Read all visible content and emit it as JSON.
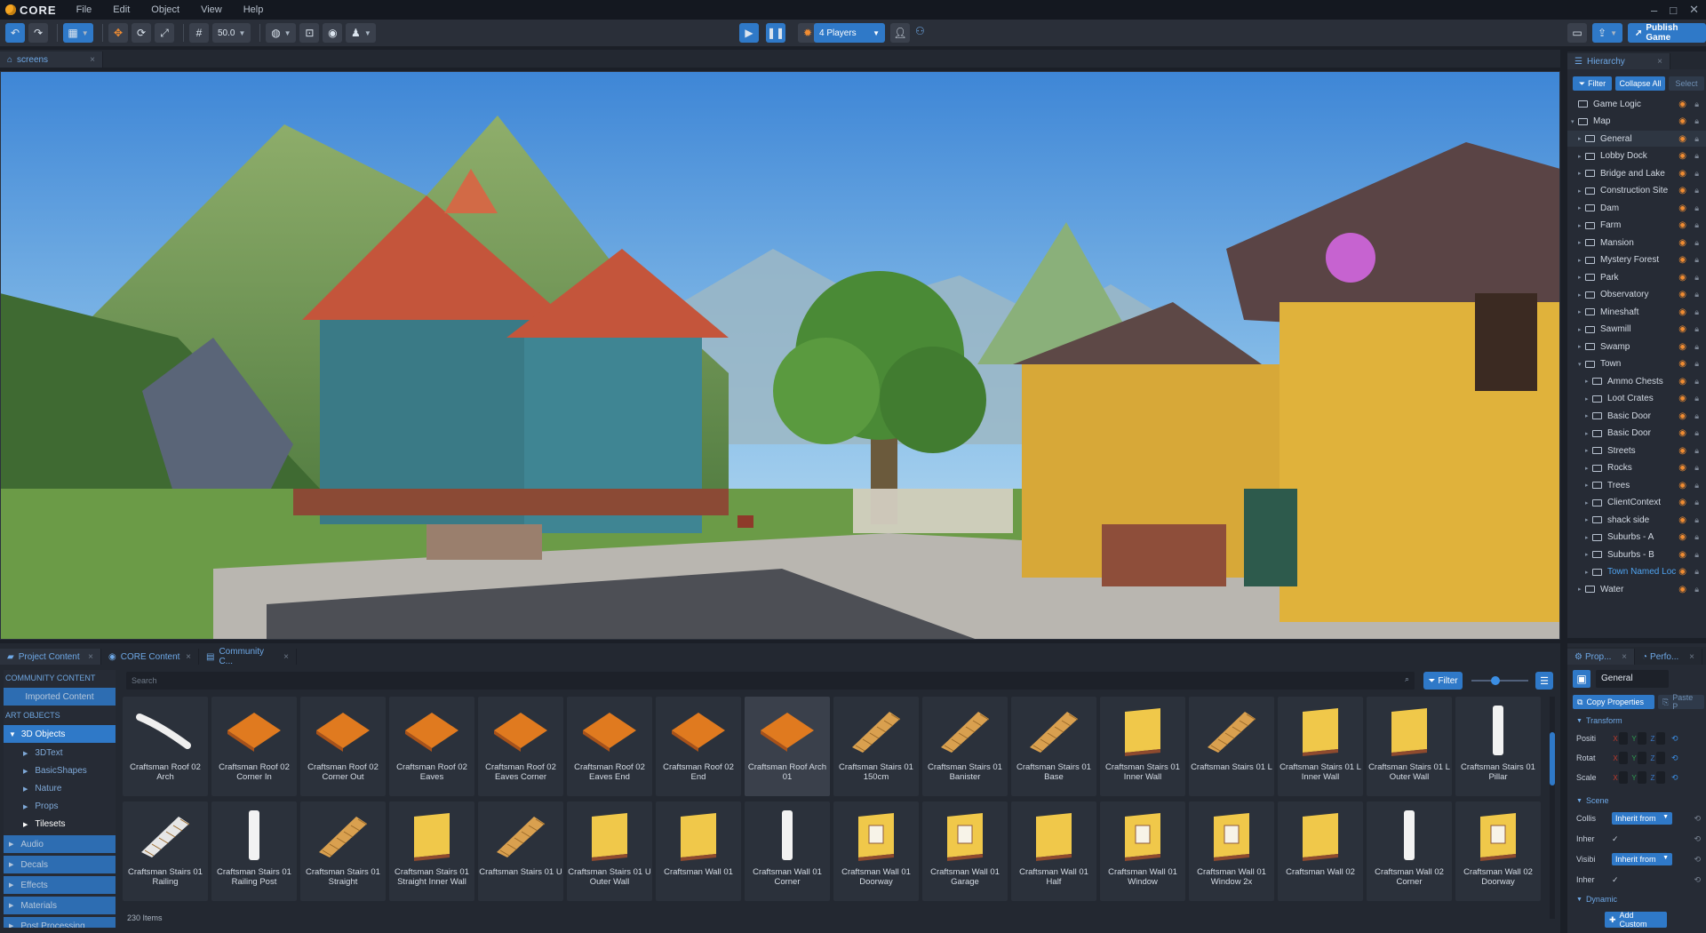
{
  "app": {
    "logo": "CORE"
  },
  "menu": [
    "File",
    "Edit",
    "Object",
    "View",
    "Help"
  ],
  "toolbar": {
    "snap_value": "50.0",
    "players_label": "4 Players",
    "publish_label": "Publish Game"
  },
  "viewport": {
    "tab_label": "screens"
  },
  "hierarchy": {
    "tab_label": "Hierarchy",
    "filter_label": "Filter",
    "collapse_label": "Collapse All",
    "select_label": "Select",
    "items": [
      {
        "label": "Game Logic",
        "depth": 0,
        "expander": ""
      },
      {
        "label": "Map",
        "depth": 0,
        "expander": "▾"
      },
      {
        "label": "General",
        "depth": 1,
        "expander": "▸",
        "selected": true
      },
      {
        "label": "Lobby Dock",
        "depth": 1,
        "expander": "▸"
      },
      {
        "label": "Bridge and Lake",
        "depth": 1,
        "expander": "▸"
      },
      {
        "label": "Construction Site",
        "depth": 1,
        "expander": "▸"
      },
      {
        "label": "Dam",
        "depth": 1,
        "expander": "▸"
      },
      {
        "label": "Farm",
        "depth": 1,
        "expander": "▸"
      },
      {
        "label": "Mansion",
        "depth": 1,
        "expander": "▸"
      },
      {
        "label": "Mystery Forest",
        "depth": 1,
        "expander": "▸"
      },
      {
        "label": "Park",
        "depth": 1,
        "expander": "▸"
      },
      {
        "label": "Observatory",
        "depth": 1,
        "expander": "▸"
      },
      {
        "label": "Mineshaft",
        "depth": 1,
        "expander": "▸"
      },
      {
        "label": "Sawmill",
        "depth": 1,
        "expander": "▸"
      },
      {
        "label": "Swamp",
        "depth": 1,
        "expander": "▸"
      },
      {
        "label": "Town",
        "depth": 1,
        "expander": "▾"
      },
      {
        "label": "Ammo Chests",
        "depth": 2,
        "expander": "▸"
      },
      {
        "label": "Loot Crates",
        "depth": 2,
        "expander": "▸"
      },
      {
        "label": "Basic Door",
        "depth": 2,
        "expander": "▸"
      },
      {
        "label": "Basic Door",
        "depth": 2,
        "expander": "▸"
      },
      {
        "label": "Streets",
        "depth": 2,
        "expander": "▸"
      },
      {
        "label": "Rocks",
        "depth": 2,
        "expander": "▸"
      },
      {
        "label": "Trees",
        "depth": 2,
        "expander": "▸"
      },
      {
        "label": "ClientContext",
        "depth": 2,
        "expander": "▸"
      },
      {
        "label": "shack side",
        "depth": 2,
        "expander": "▸"
      },
      {
        "label": "Suburbs - A",
        "depth": 2,
        "expander": "▸"
      },
      {
        "label": "Suburbs - B",
        "depth": 2,
        "expander": "▸"
      },
      {
        "label": "Town Named Loc",
        "depth": 2,
        "expander": "▸",
        "blue": true
      },
      {
        "label": "Water",
        "depth": 1,
        "expander": "▸"
      }
    ]
  },
  "content": {
    "tabs": [
      "Project Content",
      "CORE Content",
      "Community C..."
    ],
    "search_placeholder": "Search",
    "filter_label": "Filter",
    "item_count": "230 Items",
    "sidebar": {
      "community_head": "COMMUNITY CONTENT",
      "imported": "Imported Content",
      "art_head": "ART OBJECTS",
      "objects": "3D Objects",
      "children": [
        "3DText",
        "BasicShapes",
        "Nature",
        "Props",
        "Tilesets"
      ],
      "groups": [
        "Audio",
        "Decals",
        "Effects",
        "Materials",
        "Post Processing"
      ]
    },
    "items": [
      {
        "label": "Craftsman Roof 02 Arch",
        "icon": "arch-beam-icon"
      },
      {
        "label": "Craftsman Roof 02 Corner In",
        "icon": "roof-corner-in-icon"
      },
      {
        "label": "Craftsman Roof 02 Corner Out",
        "icon": "roof-corner-out-icon"
      },
      {
        "label": "Craftsman Roof 02 Eaves",
        "icon": "roof-eaves-icon"
      },
      {
        "label": "Craftsman Roof 02 Eaves Corner",
        "icon": "roof-eaves-corner-icon"
      },
      {
        "label": "Craftsman Roof 02 Eaves End",
        "icon": "roof-eaves-end-icon"
      },
      {
        "label": "Craftsman Roof 02 End",
        "icon": "roof-end-icon"
      },
      {
        "label": "Craftsman Roof Arch 01",
        "icon": "roof-arch-icon"
      },
      {
        "label": "Craftsman Stairs 01 150cm",
        "icon": "stairs-icon"
      },
      {
        "label": "Craftsman Stairs 01 Banister",
        "icon": "banister-icon"
      },
      {
        "label": "Craftsman Stairs 01 Base",
        "icon": "stairs-base-icon"
      },
      {
        "label": "Craftsman Stairs 01 Inner Wall",
        "icon": "inner-wall-icon"
      },
      {
        "label": "Craftsman Stairs 01 L",
        "icon": "stairs-l-icon"
      },
      {
        "label": "Craftsman Stairs 01 L Inner Wall",
        "icon": "l-inner-wall-icon"
      },
      {
        "label": "Craftsman Stairs 01 L Outer Wall",
        "icon": "l-outer-wall-icon"
      },
      {
        "label": "Craftsman Stairs 01 Pillar",
        "icon": "pillar-icon"
      },
      {
        "label": "Craftsman Stairs 01 Railing",
        "icon": "railing-icon"
      },
      {
        "label": "Craftsman Stairs 01 Railing Post",
        "icon": "railing-post-icon"
      },
      {
        "label": "Craftsman Stairs 01 Straight",
        "icon": "stairs-straight-icon"
      },
      {
        "label": "Craftsman Stairs 01 Straight Inner Wall",
        "icon": "straight-inner-wall-icon"
      },
      {
        "label": "Craftsman Stairs 01 U",
        "icon": "stairs-u-icon"
      },
      {
        "label": "Craftsman Stairs 01 U Outer Wall",
        "icon": "u-outer-wall-icon"
      },
      {
        "label": "Craftsman Wall 01",
        "icon": "wall-icon"
      },
      {
        "label": "Craftsman Wall 01 Corner",
        "icon": "wall-corner-icon"
      },
      {
        "label": "Craftsman Wall 01 Doorway",
        "icon": "wall-doorway-icon"
      },
      {
        "label": "Craftsman Wall 01 Garage",
        "icon": "wall-garage-icon"
      },
      {
        "label": "Craftsman Wall 01 Half",
        "icon": "wall-half-icon"
      },
      {
        "label": "Craftsman Wall 01 Window",
        "icon": "wall-window-icon"
      },
      {
        "label": "Craftsman Wall 01 Window 2x",
        "icon": "wall-window-2x-icon"
      },
      {
        "label": "Craftsman Wall 02",
        "icon": "wall-02-icon"
      },
      {
        "label": "Craftsman Wall 02 Corner",
        "icon": "wall-02-corner-icon"
      },
      {
        "label": "Craftsman Wall 02 Doorway",
        "icon": "wall-02-doorway-icon"
      }
    ]
  },
  "properties": {
    "tab_label": "Prop...",
    "perf_tab_label": "Perfo...",
    "name_value": "General",
    "copy_label": "Copy Properties",
    "paste_label": "Paste P",
    "transform_head": "Transform",
    "rows": [
      "Positi",
      "Rotat",
      "Scale"
    ],
    "axes": [
      "X",
      "Y",
      "Z"
    ],
    "scene_head": "Scene",
    "scene_rows": [
      {
        "label": "Collis",
        "value": "Inherit from"
      },
      {
        "label": "Inher",
        "value": "✓"
      },
      {
        "label": "Visibi",
        "value": "Inherit from"
      },
      {
        "label": "Inher",
        "value": "✓"
      }
    ],
    "dynamic_head": "Dynamic",
    "add_label": "Add Custom"
  },
  "colors": {
    "accent": "#2f79c8",
    "eye": "#f08c32",
    "bg": "#1b1f27"
  }
}
